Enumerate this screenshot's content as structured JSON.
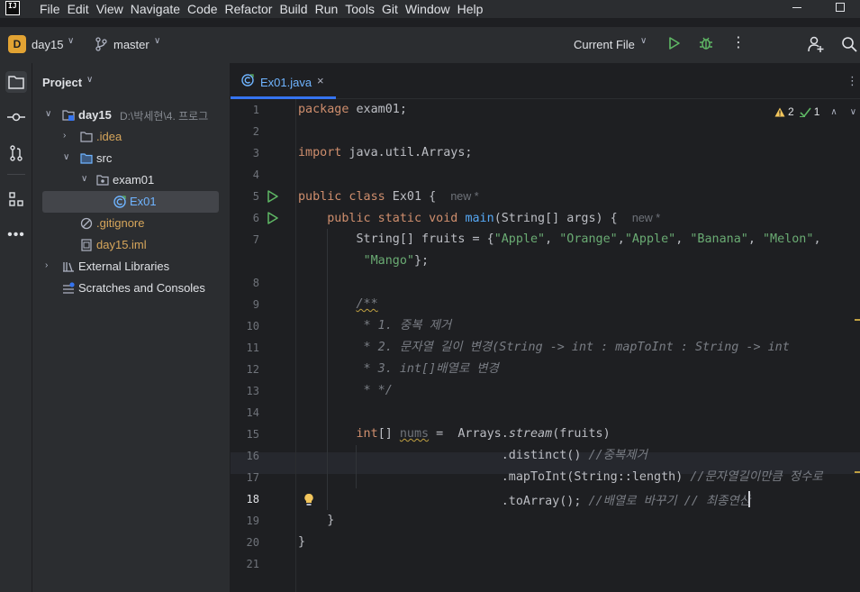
{
  "app": {
    "logo_text": "IJ"
  },
  "menu": {
    "items": [
      "File",
      "Edit",
      "View",
      "Navigate",
      "Code",
      "Refactor",
      "Build",
      "Run",
      "Tools",
      "Git",
      "Window",
      "Help"
    ]
  },
  "toolbar": {
    "project_badge": "D",
    "project_name": "day15",
    "branch": "master",
    "run_config": "Current File",
    "more": "⋮"
  },
  "project_panel": {
    "title": "Project",
    "tree": [
      {
        "label": "day15",
        "hint": "D:\\박세현\\4. 프로그",
        "depth": 0
      },
      {
        "label": ".idea",
        "depth": 1
      },
      {
        "label": "src",
        "depth": 1
      },
      {
        "label": "exam01",
        "depth": 2
      },
      {
        "label": "Ex01",
        "depth": 3
      },
      {
        "label": ".gitignore",
        "depth": 1
      },
      {
        "label": "day15.iml",
        "depth": 1
      },
      {
        "label": "External Libraries",
        "depth": 0
      },
      {
        "label": "Scratches and Consoles",
        "depth": 0
      }
    ]
  },
  "editor": {
    "tab": {
      "label": "Ex01.java",
      "close": "×"
    },
    "inspections": {
      "warnings": "2",
      "weak_warnings": "1"
    },
    "line_numbers": [
      "1",
      "2",
      "3",
      "4",
      "5",
      "6",
      "7",
      "",
      "8",
      "9",
      "10",
      "11",
      "12",
      "13",
      "14",
      "15",
      "16",
      "17",
      "18",
      "19",
      "20",
      "21"
    ],
    "inlay_new": "new *",
    "code": {
      "l1_kw": "package",
      "l1_rest": " exam01;",
      "l3_kw": "import",
      "l3_rest": " java.util.Arrays;",
      "l5_kw": "public class",
      "l5_rest": " Ex01 {",
      "l6_kw1": "public static void",
      "l6_fn": "main",
      "l6_rest": "(String[] args) {",
      "l7_pre": "String[] fruits = {",
      "l7_s1": "\"Apple\"",
      "l7_s2": "\"Orange\"",
      "l7_s3": "\"Apple\"",
      "l7_s4": "\"Banana\"",
      "l7_s5": "\"Melon\"",
      "l7b_s6": "\"Mango\"",
      "l7b_rest": "};",
      "l9": "/**",
      "l10": " * 1. 중복 제거",
      "l11": " * 2. 문자열 길이 변경(String -> int : mapToInt : String -> int",
      "l12": " * 3. int[]배열로 변경",
      "l13": " * */",
      "l15_kw": "int",
      "l15_a": "[] ",
      "l15_var": "nums",
      "l15_b": " =  Arrays.",
      "l15_fn": "stream",
      "l15_c": "(fruits)",
      "l16_code": ".distinct() ",
      "l16_cmt": "//중복제거",
      "l17_code": ".mapToInt(String::length) ",
      "l17_cmt": "//문자열길이만큼 정수로",
      "l18_code": ".toArray(); ",
      "l18_cmt": "//배열로 바꾸기 // 최종연산",
      "l19": "}",
      "l20": "}"
    }
  },
  "colors": {
    "accent": "#3574f0",
    "keyword": "#cf8e6d",
    "string": "#6aab73",
    "function": "#56a8f5",
    "comment": "#7a7e85",
    "run": "#5fb865",
    "badge": "#e2a333"
  }
}
